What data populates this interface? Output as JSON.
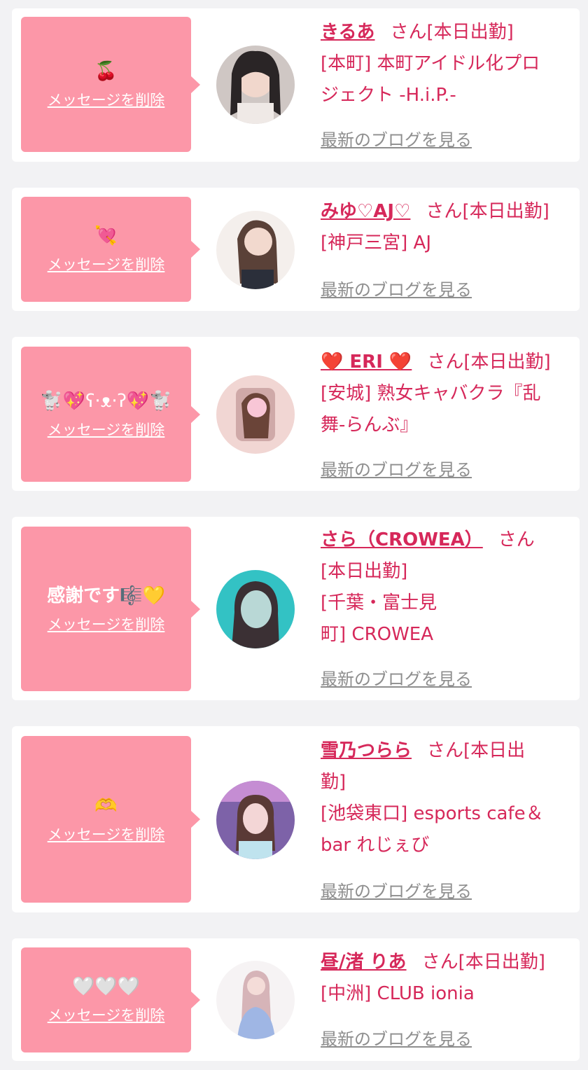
{
  "delete_label": "メッセージを削除",
  "blog_label": "最新のブログを見る",
  "suffix": "さん",
  "cards": [
    {
      "message": "🍒",
      "name": "きるあ",
      "attendance": "[本日出勤]",
      "shop_line1": "[本町] 本町アイドル化プロ",
      "shop_line2": "ジェクト -H.i.P.-"
    },
    {
      "message": "💘",
      "name": "みゆ♡AJ♡",
      "attendance": "[本日出勤]",
      "shop_line1": "[神戸三宮] AJ"
    },
    {
      "message": "🐩💖ʕ·ᴥ·ʔ💖🐩",
      "name": "❤️ ERI ❤️",
      "attendance": "[本日出勤]",
      "shop_line1": "[安城] 熟女キャバクラ『乱",
      "shop_line2": "舞-らんぶ』"
    },
    {
      "message": "感謝です🎼💛",
      "name": "さら（CROWEA）",
      "attendance": "[本日出勤]",
      "shop_line1": "[千葉・富士見",
      "shop_line2": "町] CROWEA"
    },
    {
      "message": "🫶",
      "name": "雪乃つらら",
      "attendance_line1": "[本日出",
      "attendance_line2": "勤]",
      "shop_line1": "[池袋東口] esports cafe＆",
      "shop_line2": "bar れじぇび"
    },
    {
      "message": "🤍🤍🤍",
      "name": "昼/渚 りあ",
      "attendance": "[本日出勤]",
      "shop_line1": "[中洲] CLUB ionia"
    }
  ],
  "colors": {
    "accent": "#d6285a",
    "bubble": "#fc97a8",
    "link_gray": "#8e8e8e",
    "background": "#f2f2f4"
  }
}
